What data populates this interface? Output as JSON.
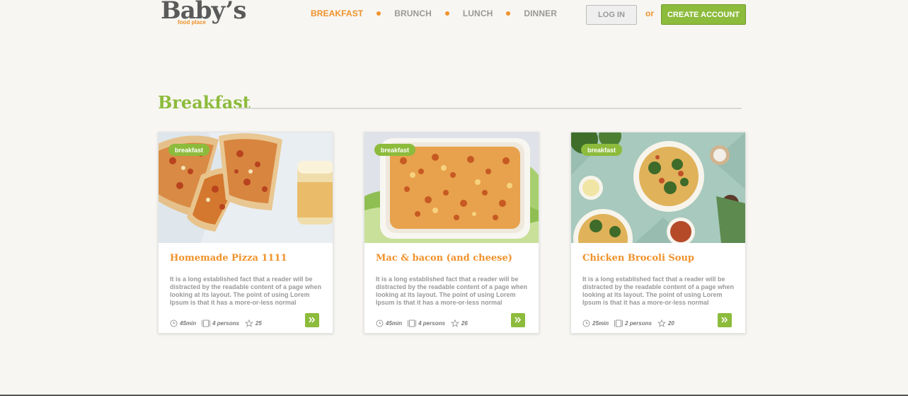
{
  "header": {
    "logo_main": "Baby’s",
    "logo_sub": "food place",
    "nav": [
      {
        "label": "BREAKFAST",
        "active": true
      },
      {
        "label": "BRUNCH",
        "active": false
      },
      {
        "label": "LUNCH",
        "active": false
      },
      {
        "label": "DINNER",
        "active": false
      }
    ],
    "login_label": "LOG IN",
    "or_label": "or",
    "create_label": "CREATE ACCOUNT"
  },
  "section": {
    "title": "Breakfast"
  },
  "cards": [
    {
      "tag": "breakfast",
      "title": "Homemade Pizza 1111",
      "description": "It is a long established fact that a reader will be distracted by the readable content of a page when looking at its layout. The point of using Lorem Ipsum is that it has a more-or-less normal",
      "time": "45min",
      "persons": "4 persons",
      "rating": "25",
      "image": "pizza"
    },
    {
      "tag": "breakfast",
      "title": "Mac & bacon (and cheese)",
      "description": "It is a long established fact that a reader will be distracted by the readable content of a page when looking at its layout. The point of using Lorem Ipsum is that it has a more-or-less normal",
      "time": "45min",
      "persons": "4 persons",
      "rating": "26",
      "image": "mac-and-cheese"
    },
    {
      "tag": "breakfast",
      "title": "Chicken Brocoli Soup",
      "description": "It is a long established fact that a reader will be distracted by the readable content of a page when looking at its layout. The point of using Lorem Ipsum is that it has a more-or-less normal",
      "time": "25min",
      "persons": "2 persons",
      "rating": "20",
      "image": "soup"
    }
  ],
  "colors": {
    "accent_orange": "#f0922b",
    "accent_green": "#8dbb3c",
    "background": "#f7f6f2"
  },
  "icons": {
    "time": "clock-icon",
    "persons": "cutlery-icon",
    "rating": "star-icon",
    "more": "double-chevron-right-icon"
  }
}
